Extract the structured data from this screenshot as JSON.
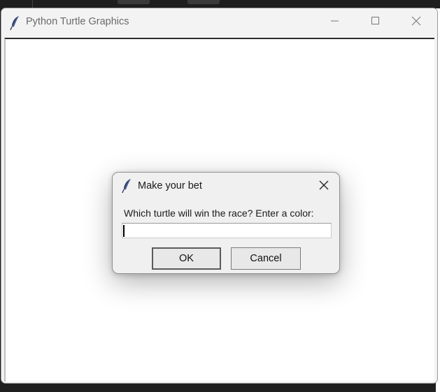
{
  "window": {
    "title": "Python Turtle Graphics",
    "icon": "feather-icon",
    "controls": {
      "minimize": "minimize-icon",
      "maximize": "maximize-icon",
      "close": "close-icon"
    }
  },
  "dialog": {
    "title": "Make your bet",
    "icon": "feather-icon",
    "prompt": "Which turtle will win the race? Enter a color:",
    "input_value": "",
    "ok_label": "OK",
    "cancel_label": "Cancel",
    "close_icon": "close-icon"
  },
  "colors": {
    "accent_feather": "#2c3e66",
    "canvas_bg": "#ffffff",
    "window_bg": "#f3f3f3"
  }
}
